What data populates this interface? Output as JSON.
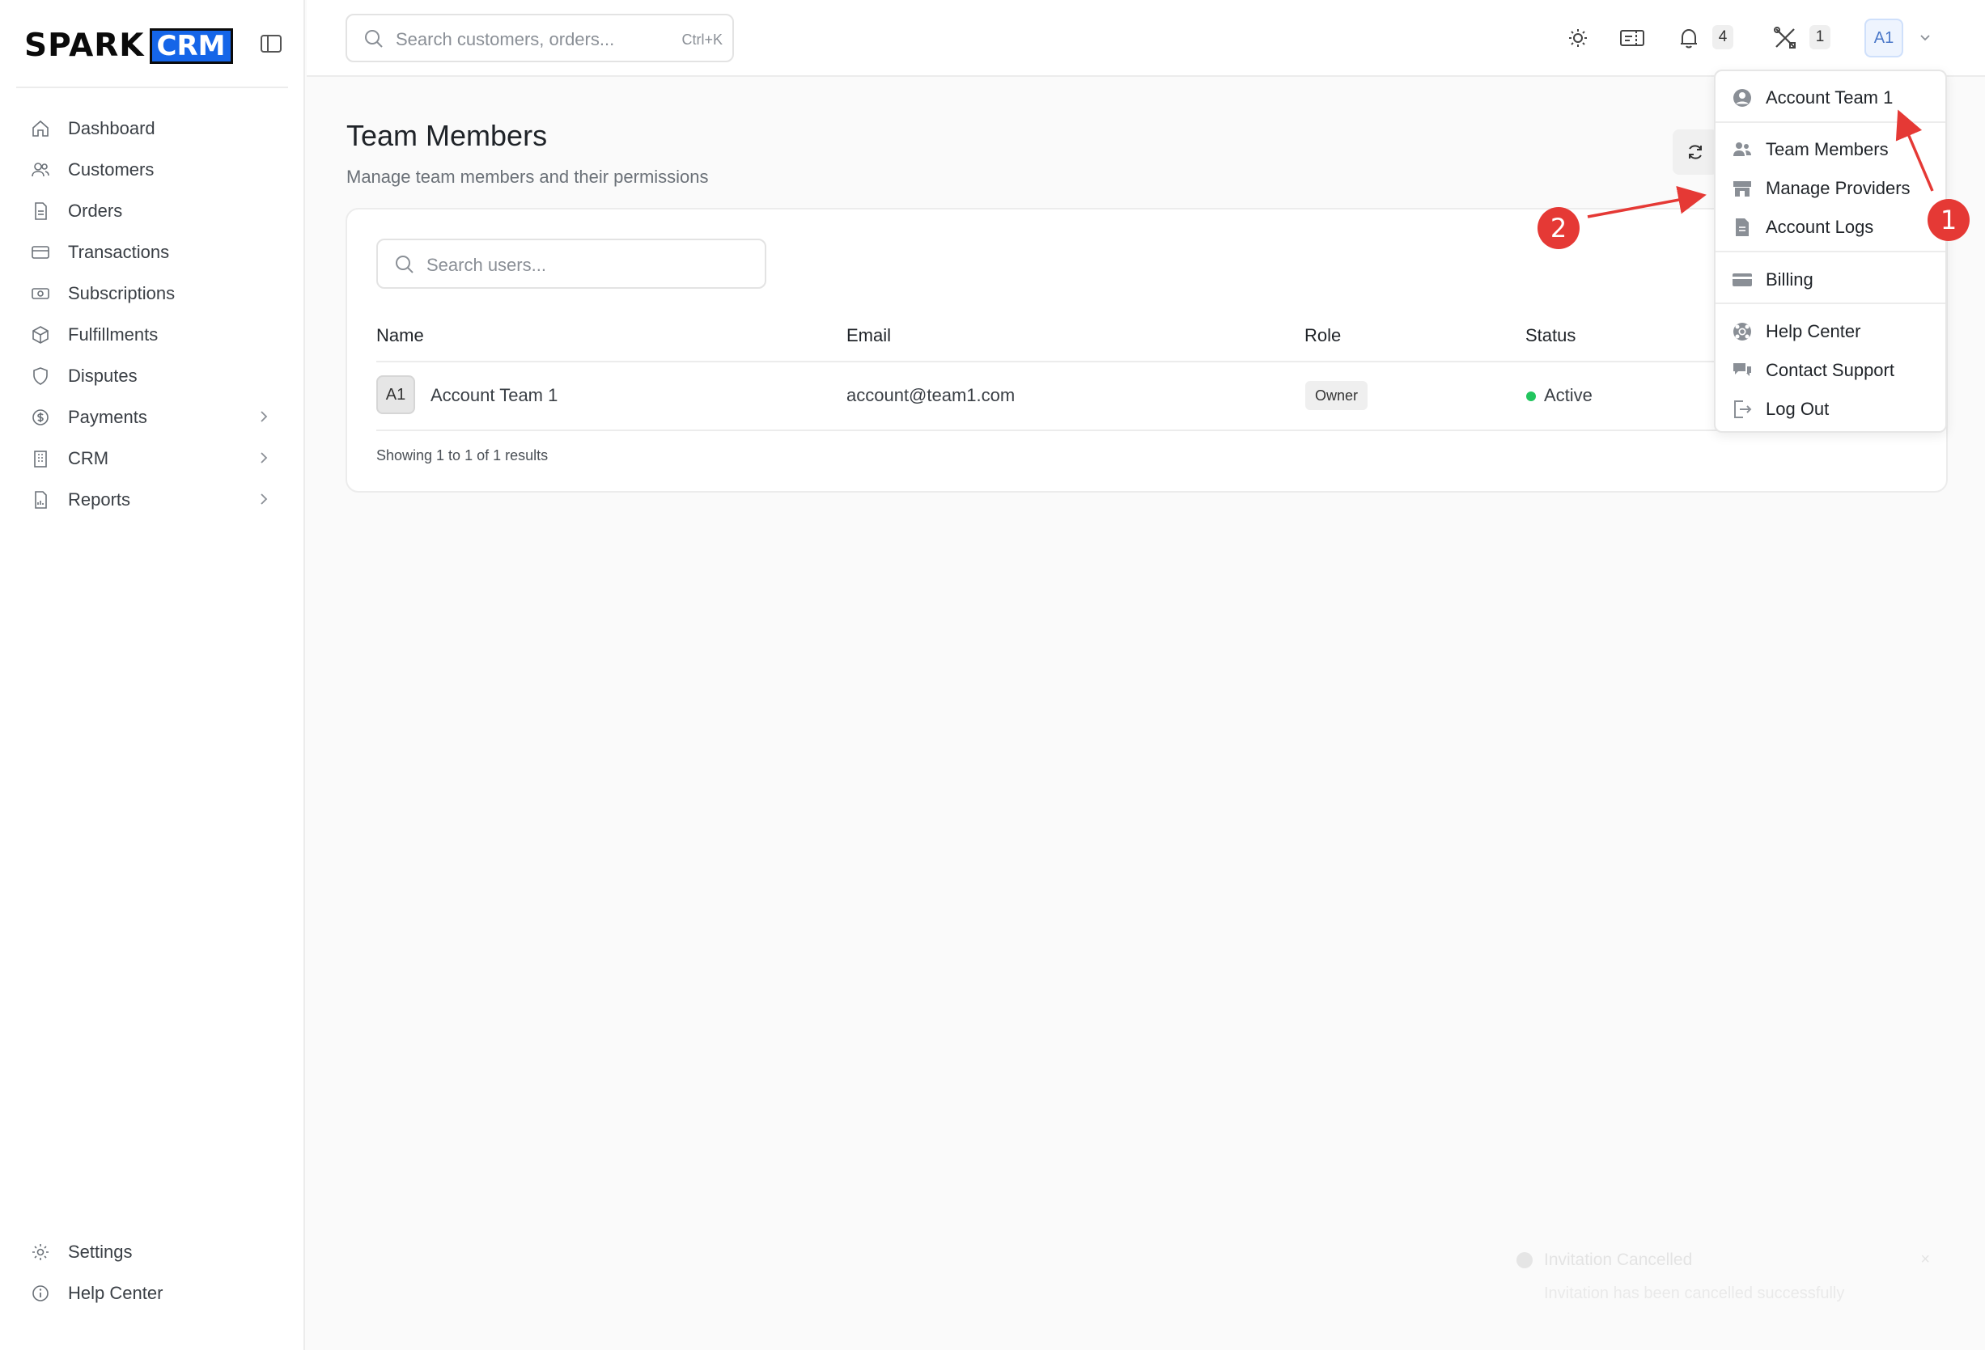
{
  "brand": {
    "name_part1": "SPARK",
    "name_part2": "CRM"
  },
  "search": {
    "placeholder": "Search customers, orders...",
    "shortcut": "Ctrl+K"
  },
  "sidebar": {
    "items": [
      {
        "label": "Dashboard",
        "icon": "home-icon"
      },
      {
        "label": "Customers",
        "icon": "users-icon"
      },
      {
        "label": "Orders",
        "icon": "document-icon"
      },
      {
        "label": "Transactions",
        "icon": "credit-card-icon"
      },
      {
        "label": "Subscriptions",
        "icon": "money-icon"
      },
      {
        "label": "Fulfillments",
        "icon": "box-icon"
      },
      {
        "label": "Disputes",
        "icon": "shield-icon"
      },
      {
        "label": "Payments",
        "icon": "dollar-circle-icon",
        "expandable": true
      },
      {
        "label": "CRM",
        "icon": "building-icon",
        "expandable": true
      },
      {
        "label": "Reports",
        "icon": "report-icon",
        "expandable": true
      }
    ],
    "bottom_items": [
      {
        "label": "Settings",
        "icon": "gear-icon"
      },
      {
        "label": "Help Center",
        "icon": "info-icon"
      }
    ]
  },
  "topbar": {
    "notifications_count": "4",
    "tools_count": "1",
    "avatar_initials": "A1"
  },
  "page": {
    "title": "Team Members",
    "subtitle": "Manage team members and their permissions"
  },
  "users_search": {
    "placeholder": "Search users..."
  },
  "table": {
    "headers": {
      "name": "Name",
      "email": "Email",
      "role": "Role",
      "status": "Status"
    },
    "rows": [
      {
        "initials": "A1",
        "name": "Account Team 1",
        "email": "account@team1.com",
        "role": "Owner",
        "status": "Active"
      }
    ],
    "footer": "Showing 1 to 1 of 1 results"
  },
  "user_menu": {
    "account_name": "Account Team 1",
    "items": [
      {
        "label": "Team Members",
        "icon": "team-icon"
      },
      {
        "label": "Manage Providers",
        "icon": "store-icon"
      },
      {
        "label": "Account Logs",
        "icon": "file-icon"
      },
      {
        "label": "Billing",
        "icon": "card-icon"
      },
      {
        "label": "Help Center",
        "icon": "lifebuoy-icon"
      },
      {
        "label": "Contact Support",
        "icon": "chat-icon"
      },
      {
        "label": "Log Out",
        "icon": "logout-icon"
      }
    ]
  },
  "annotations": {
    "first": "1",
    "second": "2"
  },
  "toast": {
    "title": "Invitation Cancelled",
    "message": "Invitation has been cancelled successfully",
    "close": "×"
  },
  "colors": {
    "brand_blue": "#1565e8",
    "annotation_red": "#e53935",
    "status_green": "#22c55e"
  }
}
